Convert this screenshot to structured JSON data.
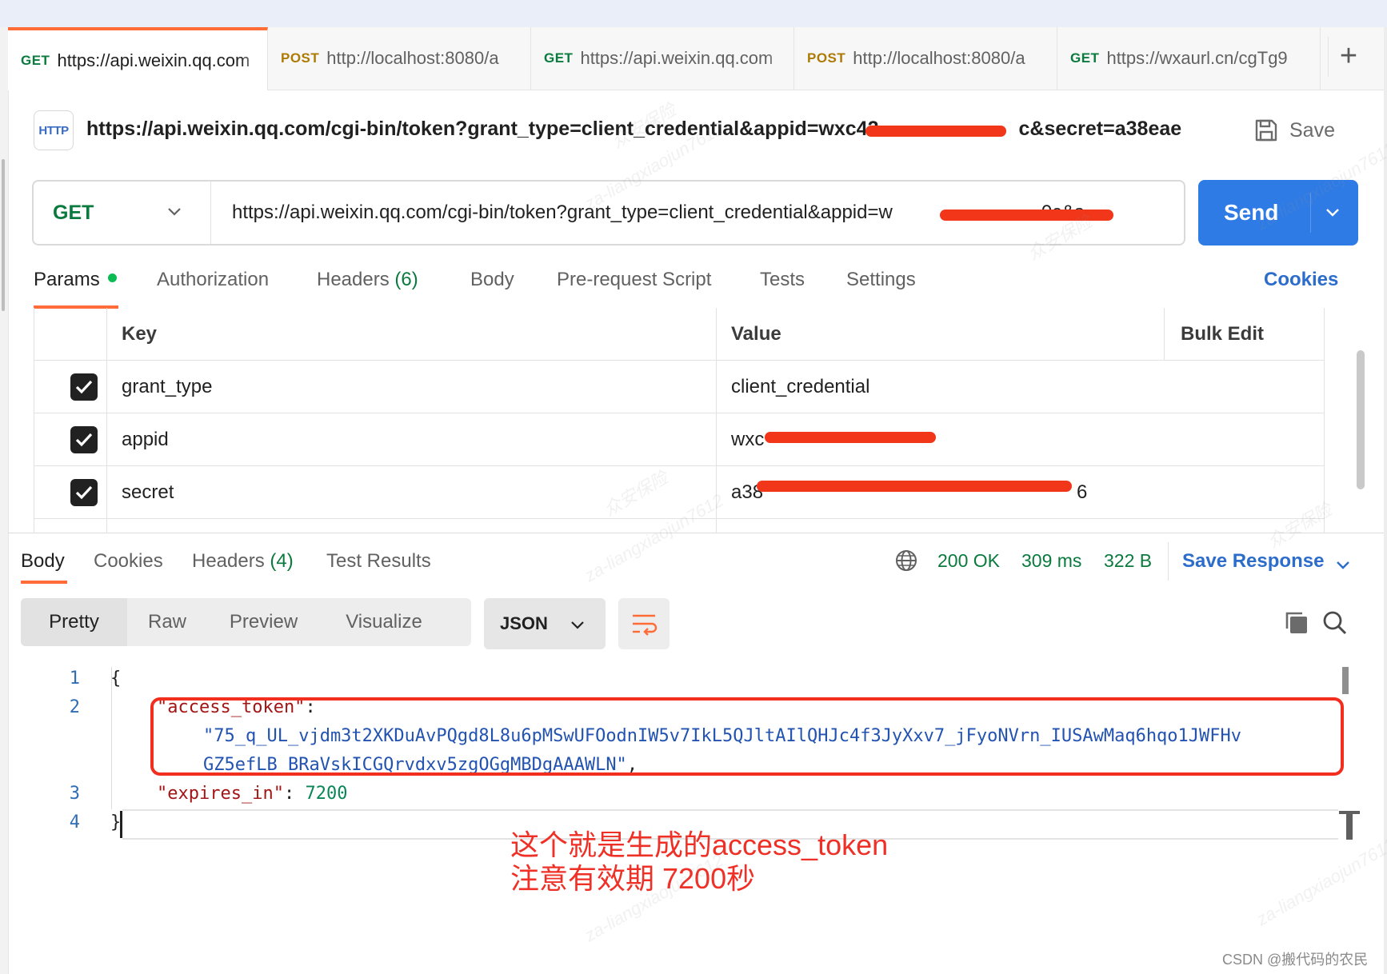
{
  "tabs": [
    {
      "method": "GET",
      "url": "https://api.weixin.qq.com"
    },
    {
      "method": "POST",
      "url": "http://localhost:8080/a"
    },
    {
      "method": "GET",
      "url": "https://api.weixin.qq.com"
    },
    {
      "method": "POST",
      "url": "http://localhost:8080/a"
    },
    {
      "method": "GET",
      "url": "https://wxaurl.cn/cgTg9"
    }
  ],
  "tab_add_label": "+",
  "request": {
    "icon_text": "HTTP",
    "title": "https://api.weixin.qq.com/cgi-bin/token?grant_type=client_credential&appid=wxc42",
    "title_tail": "c&secret=a38eae...",
    "save_label": "Save",
    "method": "GET",
    "url": "https://api.weixin.qq.com/cgi-bin/token?grant_type=client_credential&appid=w",
    "url_tail": "0c&s…",
    "send_label": "Send"
  },
  "request_tabs": {
    "params": "Params",
    "authorization": "Authorization",
    "headers": "Headers",
    "headers_count": "(6)",
    "body": "Body",
    "prerequest": "Pre-request Script",
    "tests": "Tests",
    "settings": "Settings",
    "cookies": "Cookies"
  },
  "params_table": {
    "key_header": "Key",
    "value_header": "Value",
    "bulk_edit": "Bulk Edit",
    "rows": [
      {
        "key": "grant_type",
        "value": "client_credential",
        "checked": true
      },
      {
        "key": "appid",
        "value": "wxc",
        "checked": true
      },
      {
        "key": "secret",
        "value": "a38",
        "value_tail": "6",
        "checked": true
      }
    ]
  },
  "response_tabs": {
    "body": "Body",
    "cookies": "Cookies",
    "headers": "Headers",
    "headers_count": "(4)",
    "test_results": "Test Results"
  },
  "response_status": {
    "status": "200 OK",
    "time": "309 ms",
    "size": "322 B",
    "save_response": "Save Response"
  },
  "format_toolbar": {
    "pretty": "Pretty",
    "raw": "Raw",
    "preview": "Preview",
    "visualize": "Visualize",
    "language": "JSON"
  },
  "code": {
    "line_numbers": [
      "1",
      "2",
      "3",
      "4"
    ],
    "open_brace": "{",
    "key_access_token": "\"access_token\"",
    "colon": ":",
    "token_part1": "\"75_q_UL_vjdm3t2XKDuAvPQgd8L8u6pMSwUFOodnIW5v7IkL5QJltAIlQHJc4f3JyXxv7_jFyoNVrn_IUSAwMaq6hqo1JWFHv",
    "token_part2": "GZ5efLB_BRaVskICGQrvdxv5zgOGgMBDgAAAWLN\"",
    "comma": ",",
    "key_expires_in": "\"expires_in\"",
    "colon_space": ": ",
    "expires_value": "7200",
    "close_brace": "}"
  },
  "annotation": {
    "line1": "这个就是生成的access_token",
    "line2": "注意有效期 7200秒"
  },
  "watermarks": {
    "cn": "众安保险",
    "id": "za-liangxiaojun7612"
  },
  "footer_watermark": "CSDN @搬代码的农民",
  "colors": {
    "accent": "#ff6c37",
    "send_button": "#2e7be6",
    "link": "#2c6ccb",
    "status_green": "#0b7a3e",
    "redaction": "#f2361a",
    "highlight_box": "#f22e1f"
  }
}
